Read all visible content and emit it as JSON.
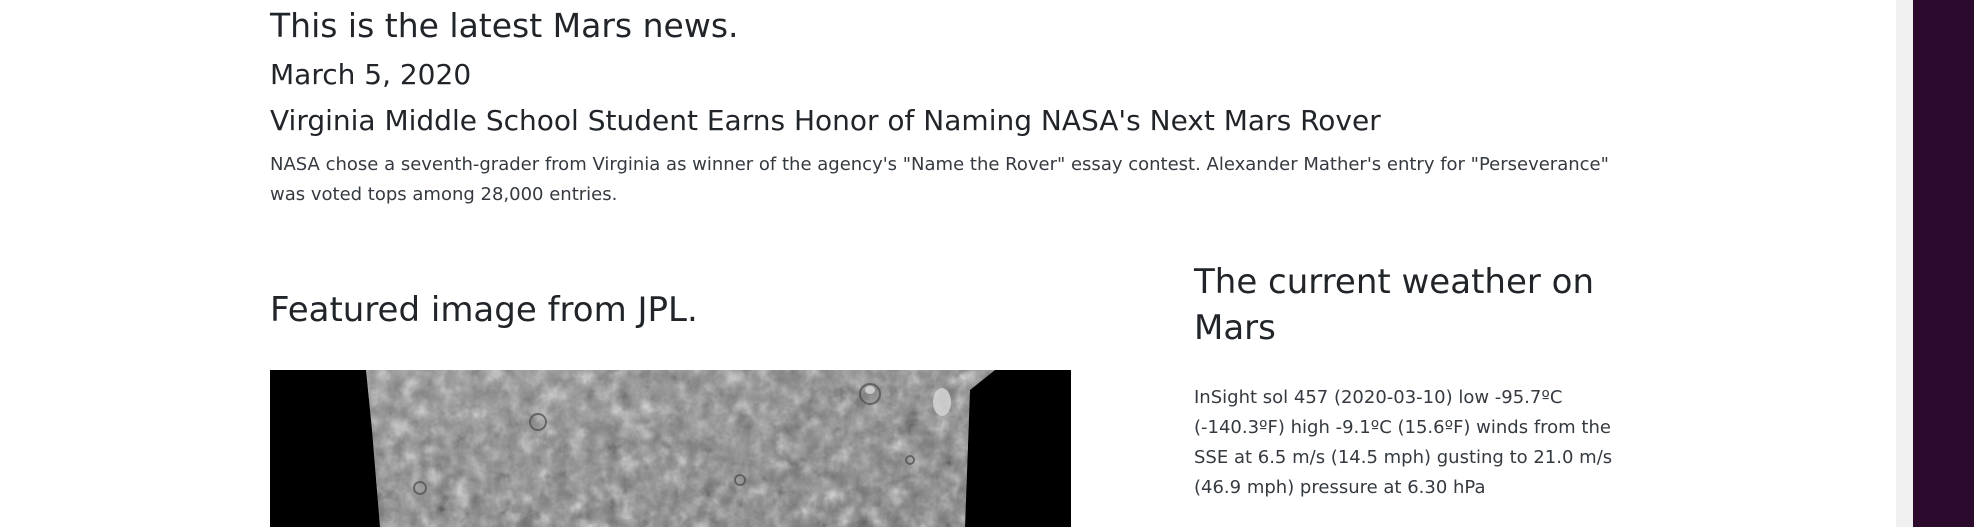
{
  "news": {
    "section_heading": "This is the latest Mars news.",
    "date": "March 5, 2020",
    "title": "Virginia Middle School Student Earns Honor of Naming NASA's Next Mars Rover",
    "teaser": "NASA chose a seventh-grader from Virginia as winner of the agency's \"Name the Rover\" essay contest. Alexander Mather's entry for \"Perseverance\" was voted tops among 28,000 entries."
  },
  "featured": {
    "heading": "Featured image from JPL."
  },
  "weather": {
    "heading": "The current weather on Mars",
    "report": "InSight sol 457 (2020-03-10) low -95.7ºC (-140.3ºF) high -9.1ºC (15.6ºF) winds from the SSE at 6.5 m/s (14.5 mph) gusting to 21.0 m/s (46.9 mph) pressure at 6.30 hPa"
  },
  "colors": {
    "page_background": "#ffffff",
    "text": "#212529",
    "side_panel": "#2c0a2e",
    "image_background": "#000000"
  }
}
